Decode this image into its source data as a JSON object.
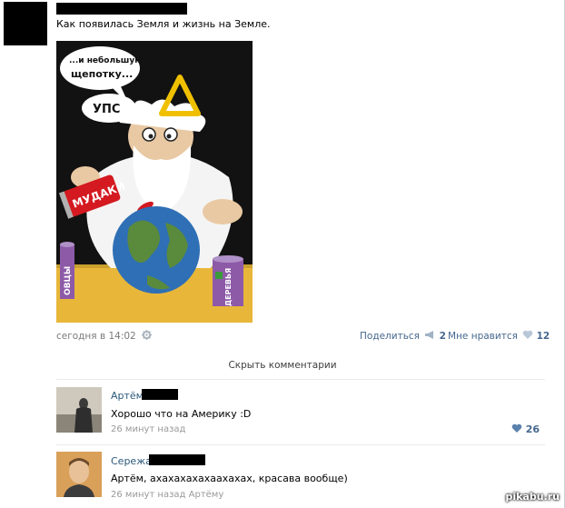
{
  "post": {
    "text": "Как появилась Земля и жизнь на Земле.",
    "comic": {
      "bubble_line1": "...и небольшую",
      "bubble_line2": "щепотку...",
      "oops": "УПС",
      "can_red": "МУДАКИ",
      "can_left": "ОВЦЫ",
      "can_right": "ДЕРЕВЬЯ"
    },
    "time": "сегодня в 14:02",
    "share_label": "Поделиться",
    "share_count": "2",
    "like_label": "Мне нравится",
    "like_count": "12"
  },
  "comments_toggle": "Скрыть комментарии",
  "comments": [
    {
      "name": "Артём",
      "text": "Хорошо что на Америку :D",
      "time": "26 минут назад",
      "likes": "26"
    },
    {
      "name": "Сережа",
      "text": "Артём, ахахахахахаахахах, красава вообще)",
      "time": "26 минут назад",
      "reply_to": "Артёму"
    }
  ],
  "watermark": "pikabu.ru",
  "colors": {
    "link": "#2b587a",
    "meta": "#45688e",
    "separator": "#e7eaed"
  }
}
